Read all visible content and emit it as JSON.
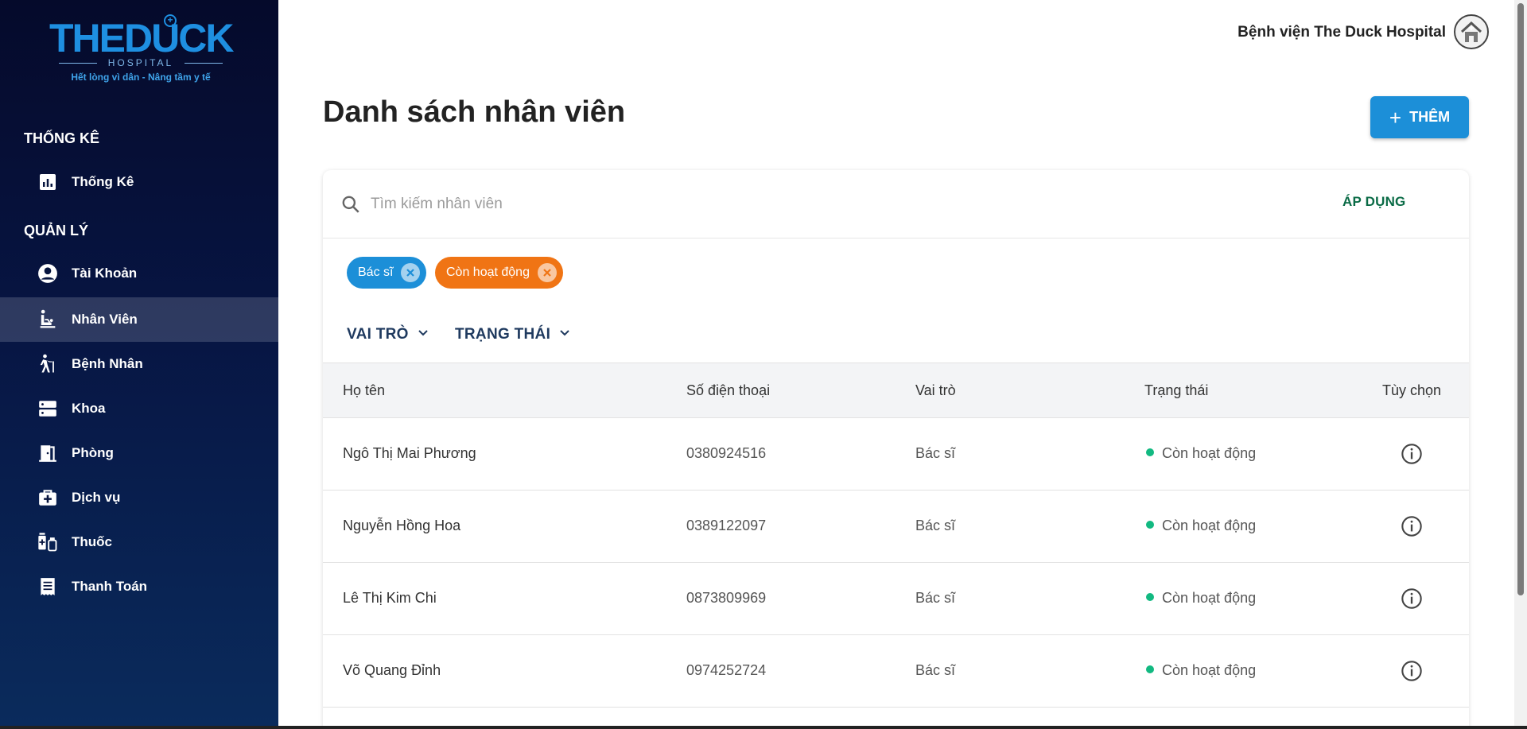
{
  "sidebar": {
    "logo": {
      "main": "THEDUCK",
      "sub": "HOSPITAL",
      "slogan": "Hết lòng vì dân - Nâng tầm y tế"
    },
    "sections": [
      {
        "title": "THỐNG KÊ",
        "items": [
          {
            "label": "Thống Kê",
            "icon": "chart-icon"
          }
        ]
      },
      {
        "title": "QUẢN LÝ",
        "items": [
          {
            "label": "Tài Khoản",
            "icon": "account-icon"
          },
          {
            "label": "Nhân Viên",
            "icon": "staff-icon",
            "active": true
          },
          {
            "label": "Bệnh Nhân",
            "icon": "patient-icon"
          },
          {
            "label": "Khoa",
            "icon": "department-icon"
          },
          {
            "label": "Phòng",
            "icon": "room-icon"
          },
          {
            "label": "Dịch vụ",
            "icon": "service-icon"
          },
          {
            "label": "Thuốc",
            "icon": "medicine-icon"
          },
          {
            "label": "Thanh Toán",
            "icon": "payment-icon"
          }
        ]
      }
    ]
  },
  "header": {
    "hospital_name": "Bệnh viện The Duck Hospital",
    "avatar_icon": "hospital-avatar-icon"
  },
  "main": {
    "title": "Danh sách nhân viên",
    "add_button": {
      "label": "THÊM",
      "icon": "plus-icon"
    },
    "search": {
      "placeholder": "Tìm kiếm nhân viên",
      "value": "",
      "apply_label": "ÁP DỤNG"
    },
    "chips": [
      {
        "label": "Bác sĩ",
        "color": "#1c8fd8"
      },
      {
        "label": "Còn hoạt động",
        "color": "#f07414"
      }
    ],
    "filters": [
      {
        "label": "VAI TRÒ"
      },
      {
        "label": "TRẠNG THÁI"
      }
    ],
    "table": {
      "columns": [
        "Họ tên",
        "Số điện thoại",
        "Vai trò",
        "Trạng thái",
        "Tùy chọn"
      ],
      "rows": [
        {
          "name": "Ngô Thị Mai Phương",
          "phone": "0380924516",
          "role": "Bác sĩ",
          "status": "Còn hoạt động"
        },
        {
          "name": "Nguyễn Hồng Hoa",
          "phone": "0389122097",
          "role": "Bác sĩ",
          "status": "Còn hoạt động"
        },
        {
          "name": "Lê Thị Kim Chi",
          "phone": "0873809969",
          "role": "Bác sĩ",
          "status": "Còn hoạt động"
        },
        {
          "name": "Võ Quang Đỉnh",
          "phone": "0974252724",
          "role": "Bác sĩ",
          "status": "Còn hoạt động"
        }
      ]
    }
  },
  "colors": {
    "accent": "#1c8fd8",
    "status_active": "#12b981",
    "chip_orange": "#f07414",
    "apply": "#0a6b46"
  }
}
